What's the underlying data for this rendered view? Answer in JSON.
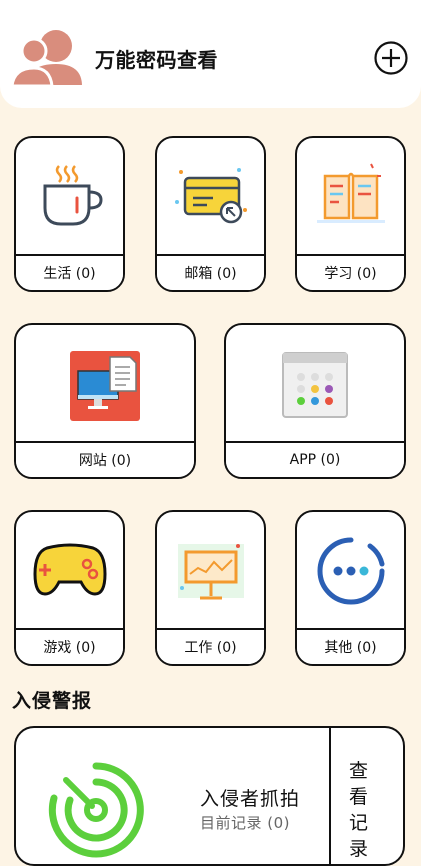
{
  "header": {
    "title": "万能密码查看",
    "avatar_icon": "user-avatar-icon",
    "add_icon": "plus-circle-icon"
  },
  "categories": [
    {
      "label": "生活 (0)",
      "icon": "coffee-cup-icon"
    },
    {
      "label": "邮箱 (0)",
      "icon": "mail-card-icon"
    },
    {
      "label": "学习 (0)",
      "icon": "open-book-icon"
    },
    {
      "label": "网站 (0)",
      "icon": "monitor-icon"
    },
    {
      "label": "APP (0)",
      "icon": "app-grid-icon"
    },
    {
      "label": "游戏 (0)",
      "icon": "gamepad-icon"
    },
    {
      "label": "工作 (0)",
      "icon": "chart-board-icon"
    },
    {
      "label": "其他 (0)",
      "icon": "more-dots-icon"
    }
  ],
  "intrusion": {
    "section_title": "入侵警报",
    "capture_title": "入侵者抓拍",
    "capture_subtitle": "目前记录 (0)",
    "view_records": "查看记录",
    "radar_icon": "radar-icon"
  },
  "colors": {
    "background": "#fdf4e5",
    "accent_green": "#5ccf3c",
    "avatar": "#d98d7d"
  }
}
